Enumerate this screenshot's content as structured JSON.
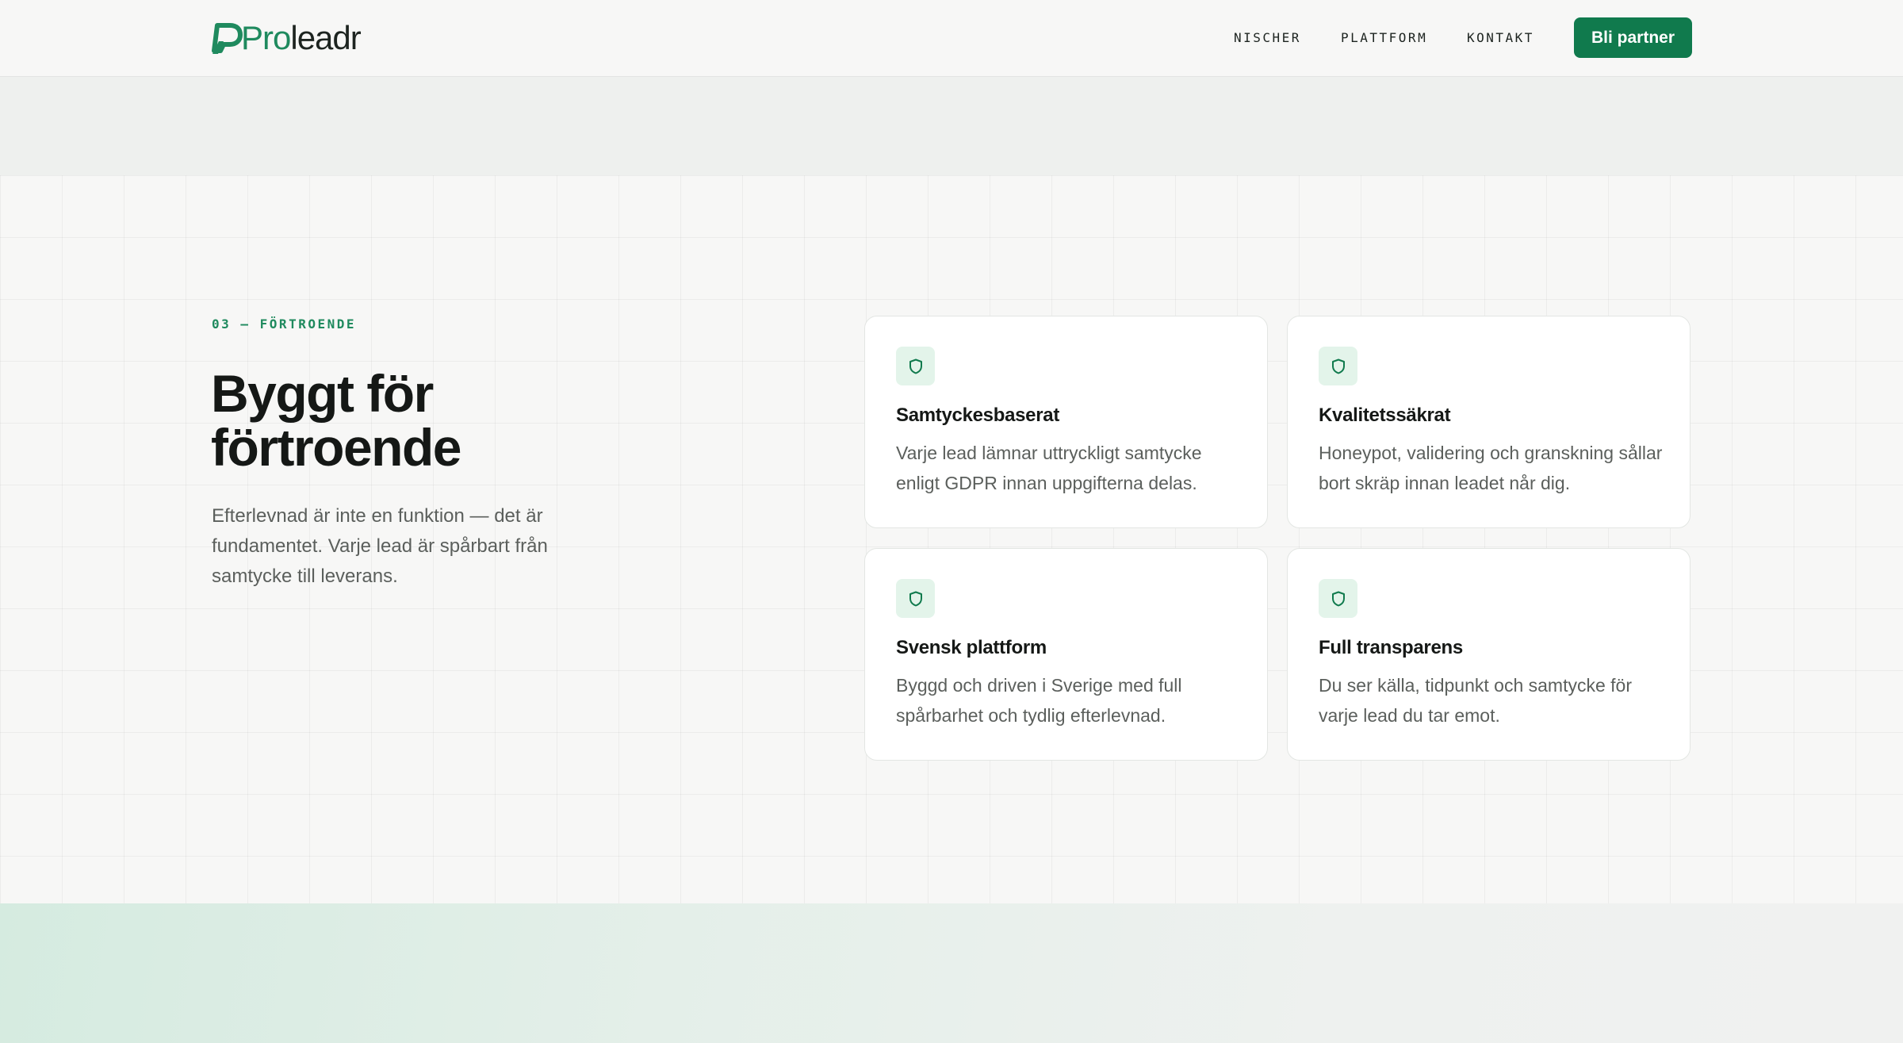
{
  "header": {
    "logo": {
      "pro": "Pro",
      "rest": "leadr"
    },
    "nav": [
      "NISCHER",
      "PLATTFORM",
      "KONTAKT"
    ],
    "cta_label": "Bli partner"
  },
  "trust": {
    "eyebrow": "03 — FÖRTROENDE",
    "headline_line1": "Byggt för",
    "headline_line2": "förtroende",
    "lead": "Efterlevnad är inte en funktion — det är fundamentet. Varje lead är spårbart från samtycke till leverans.",
    "cards": [
      {
        "icon": "shield-icon",
        "title": "Samtyckesbaserat",
        "text": "Varje lead lämnar uttryckligt samtycke enligt GDPR innan uppgifterna delas."
      },
      {
        "icon": "shield-icon",
        "title": "Kvalitetssäkrat",
        "text": "Honeypot, validering och granskning sållar bort skräp innan leadet når dig."
      },
      {
        "icon": "shield-icon",
        "title": "Svensk plattform",
        "text": "Byggd och driven i Sverige med full spårbarhet och tydlig efterlevnad."
      },
      {
        "icon": "shield-icon",
        "title": "Full transparens",
        "text": "Du ser källa, tidpunkt och samtycke för varje lead du tar emot."
      }
    ]
  },
  "colors": {
    "brand": "#107a4d",
    "accent": "#1f8a5e",
    "icon_bg": "#e3f4ea"
  }
}
